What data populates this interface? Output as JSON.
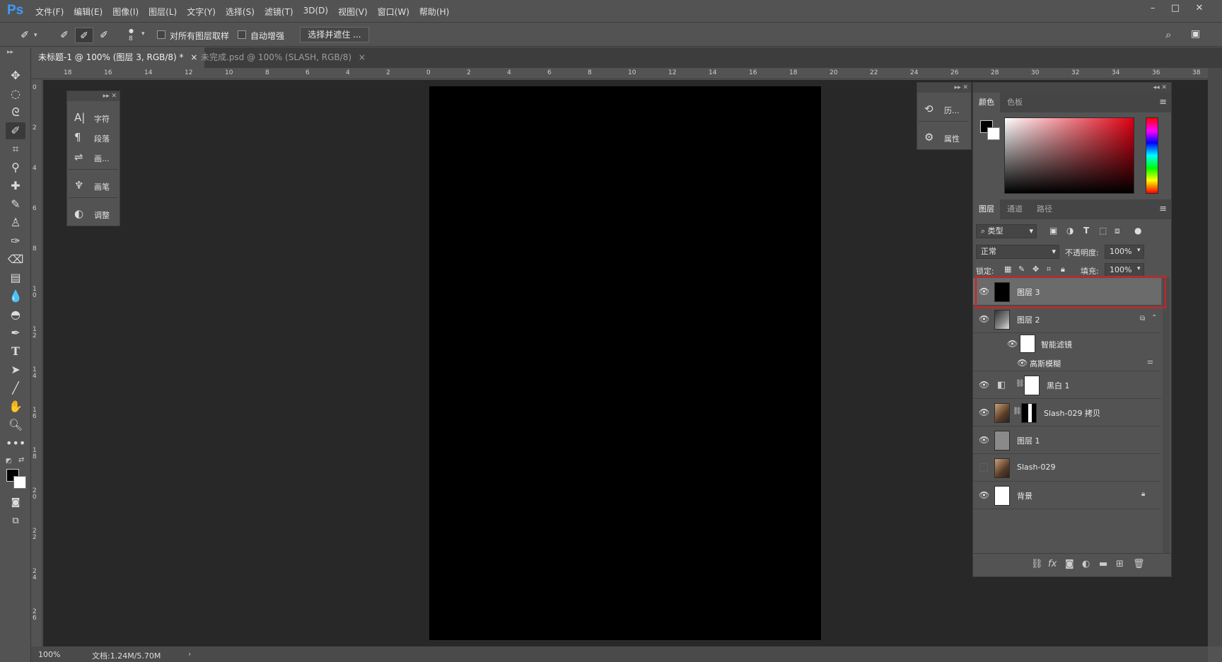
{
  "app": {
    "logo": "Ps",
    "menu": [
      "文件(F)",
      "编辑(E)",
      "图像(I)",
      "图层(L)",
      "文字(Y)",
      "选择(S)",
      "滤镜(T)",
      "3D(D)",
      "视图(V)",
      "窗口(W)",
      "帮助(H)"
    ]
  },
  "options": {
    "brush_size": "8",
    "sample_all_layers": "对所有图层取样",
    "auto_enhance": "自动增强",
    "select_and_mask": "选择并遮住 ..."
  },
  "tabs": [
    {
      "label": "未标题-1 @ 100% (图层 3, RGB/8) *",
      "close": "×"
    },
    {
      "label": "未完成.psd @ 100% (SLASH, RGB/8)",
      "close": "×"
    }
  ],
  "ruler_top": [
    "18",
    "16",
    "14",
    "12",
    "10",
    "8",
    "6",
    "4",
    "2",
    "0",
    "2",
    "4",
    "6",
    "8",
    "10",
    "12",
    "14",
    "16",
    "18",
    "20",
    "22",
    "24",
    "26",
    "28",
    "30",
    "32",
    "34",
    "36",
    "38"
  ],
  "ruler_left": [
    "0",
    "2",
    "4",
    "6",
    "8",
    "10",
    "12",
    "14",
    "16",
    "18",
    "20",
    "22",
    "24",
    "26"
  ],
  "status": {
    "zoom": "100%",
    "doc": "文档:1.24M/5.70M"
  },
  "char_panel": {
    "items": [
      {
        "icon": "A|",
        "label": "字符"
      },
      {
        "icon": "¶",
        "label": "段落"
      },
      {
        "icon": "⇌",
        "label": "画..."
      },
      {
        "icon": "♆",
        "label": "画笔"
      },
      {
        "icon": "◐",
        "label": "调整"
      }
    ]
  },
  "hist_panel": {
    "items": [
      {
        "label": "历..."
      },
      {
        "label": "属性"
      }
    ]
  },
  "color_panel": {
    "tabs": [
      "颜色",
      "色板"
    ],
    "fg_color": "#000000",
    "bg_color": "#ffffff"
  },
  "layers_panel": {
    "tabs": [
      "图层",
      "通道",
      "路径"
    ],
    "filter_kind": "类型",
    "blend_mode": "正常",
    "opacity_label": "不透明度:",
    "opacity": "100%",
    "lock_label": "锁定:",
    "fill_label": "填充:",
    "fill": "100%",
    "layers": [
      {
        "name": "图层 3",
        "visible": true,
        "selected": true
      },
      {
        "name": "图层 2",
        "visible": true,
        "smart": true
      },
      {
        "name": "智能滤镜",
        "visible": true,
        "sub": true
      },
      {
        "name": "高斯模糊",
        "visible": true,
        "sub": true
      },
      {
        "name": "黑白 1",
        "visible": true,
        "adjustment": true
      },
      {
        "name": "Slash-029 拷贝",
        "visible": true,
        "masked": true
      },
      {
        "name": "图层 1",
        "visible": true
      },
      {
        "name": "Slash-029",
        "visible": false
      },
      {
        "name": "背景",
        "visible": true,
        "locked": true
      }
    ]
  }
}
